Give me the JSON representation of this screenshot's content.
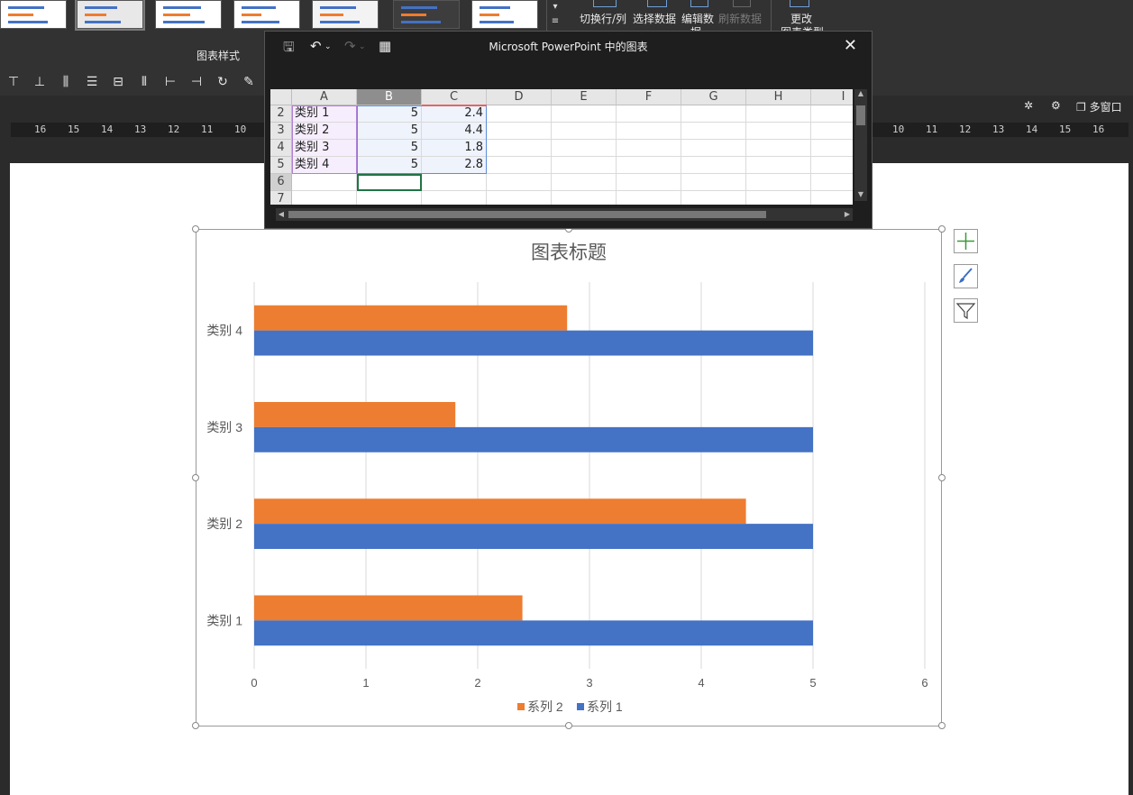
{
  "ribbon": {
    "chart_styles_label": "图表样式",
    "switch_row_col": "切换行/列",
    "select_data": "选择数据",
    "edit_data": "编辑数",
    "edit_data_line2": "据",
    "refresh_data": "刷新数据",
    "change_chart_type": "更改",
    "change_chart_type_line2": "图表类型",
    "multi_window": "多窗口"
  },
  "ruler": {
    "left_ticks": [
      "16",
      "15",
      "14",
      "13",
      "12",
      "11",
      "10"
    ],
    "right_ticks": [
      "10",
      "11",
      "12",
      "13",
      "14",
      "15",
      "16"
    ]
  },
  "sheet": {
    "title": "Microsoft PowerPoint 中的图表",
    "columns": [
      "A",
      "B",
      "C",
      "D",
      "E",
      "F",
      "G",
      "H",
      "I"
    ],
    "rows": [
      {
        "num": "2",
        "a": "类别 1",
        "b": "5",
        "c": "2.4"
      },
      {
        "num": "3",
        "a": "类别 2",
        "b": "5",
        "c": "4.4"
      },
      {
        "num": "4",
        "a": "类别 3",
        "b": "5",
        "c": "1.8"
      },
      {
        "num": "5",
        "a": "类别 4",
        "b": "5",
        "c": "2.8"
      },
      {
        "num": "6",
        "a": "",
        "b": "",
        "c": ""
      },
      {
        "num": "7",
        "a": "",
        "b": "",
        "c": ""
      }
    ]
  },
  "chart_data": {
    "type": "bar",
    "orientation": "horizontal",
    "title": "图表标题",
    "categories": [
      "类别 1",
      "类别 2",
      "类别 3",
      "类别 4"
    ],
    "series": [
      {
        "name": "系列 2",
        "values": [
          2.4,
          4.4,
          1.8,
          2.8
        ],
        "color": "#ED7D31"
      },
      {
        "name": "系列 1",
        "values": [
          5,
          5,
          5,
          5
        ],
        "color": "#4472C4"
      }
    ],
    "xlim": [
      0,
      6
    ],
    "xticks": [
      0,
      1,
      2,
      3,
      4,
      5,
      6
    ],
    "grid": true,
    "legend_position": "bottom"
  },
  "colors": {
    "accent_orange": "#ED7D31",
    "accent_blue": "#4472C4",
    "ribbon_bg": "#323232",
    "selection_green": "#217346"
  },
  "icons": {
    "add_element": "plus-icon",
    "chart_style": "brush-icon",
    "chart_filter": "filter-icon"
  }
}
